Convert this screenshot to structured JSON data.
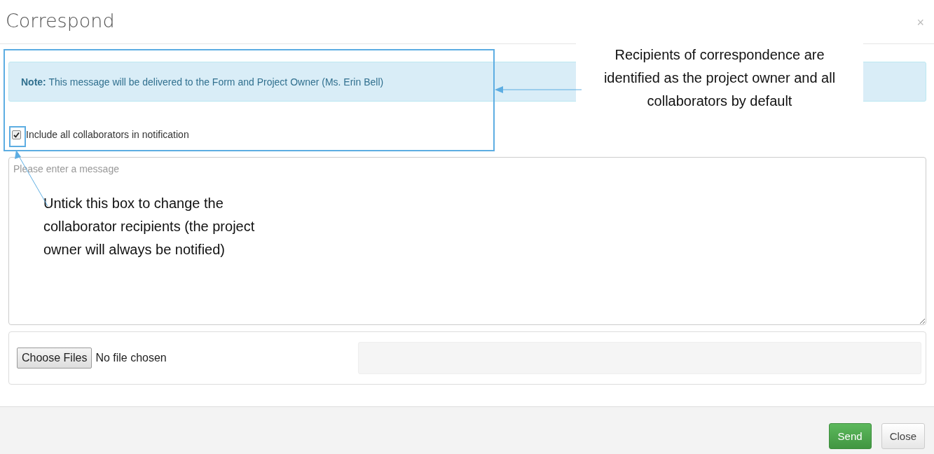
{
  "dialog": {
    "title": "Correspond",
    "close_glyph": "×"
  },
  "note": {
    "label": "Note:",
    "text": "This message will be delivered to the Form and Project Owner (Ms. Erin Bell)"
  },
  "include_collaborators": {
    "label": "Include all collaborators in notification",
    "checked": true
  },
  "message": {
    "placeholder": "Please enter a message"
  },
  "attachments": {
    "button": "Choose Files",
    "status": "No file chosen"
  },
  "buttons": [
    {
      "label": "Send",
      "kind": "primary"
    },
    {
      "label": "Close",
      "kind": "default"
    }
  ],
  "annotations": [
    {
      "text": "Recipients of correspondence are identified as the project owner and all collaborators by default",
      "kind": "right"
    },
    {
      "text": "Untick this box to change the collaborator recipients (the project owner will always be notified)",
      "kind": "left"
    }
  ]
}
